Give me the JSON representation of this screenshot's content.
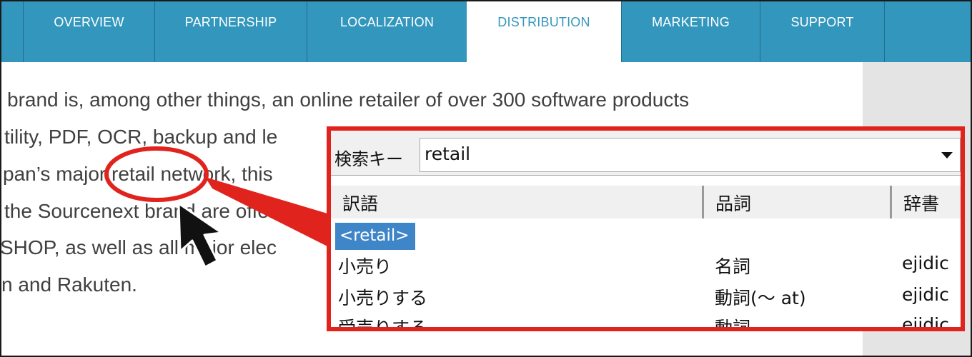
{
  "nav": {
    "tabs": [
      {
        "label": "OVERVIEW"
      },
      {
        "label": "PARTNERSHIP"
      },
      {
        "label": "LOCALIZATION"
      },
      {
        "label": "DISTRIBUTION",
        "active": true
      },
      {
        "label": "MARKETING"
      },
      {
        "label": "SUPPORT"
      }
    ]
  },
  "article": {
    "lines": [
      "brand is, among other things, an online retailer of over 300 software products",
      "tility, PDF, OCR, backup and le",
      "pan’s major retail network, this",
      "the Sourcenext brand are offer",
      "SHOP, as well as all major elec",
      "n and Rakuten."
    ]
  },
  "dictionary": {
    "search_label": "検索キー",
    "search_value": "retail",
    "columns": {
      "translation": "訳語",
      "pos": "品詞",
      "dict": "辞書"
    },
    "selected_entry": "<retail>",
    "rows": [
      {
        "translation": "小売り",
        "pos": "名詞",
        "dict": "ejidic"
      },
      {
        "translation": "小売りする",
        "pos": "動詞(〜 at)",
        "dict": "ejidic"
      },
      {
        "translation": "受売りする",
        "pos": "動詞",
        "dict": "ejidic"
      }
    ]
  },
  "colors": {
    "nav": "#3397bd",
    "annotation": "#e0231d",
    "selection": "#3f86c9"
  }
}
